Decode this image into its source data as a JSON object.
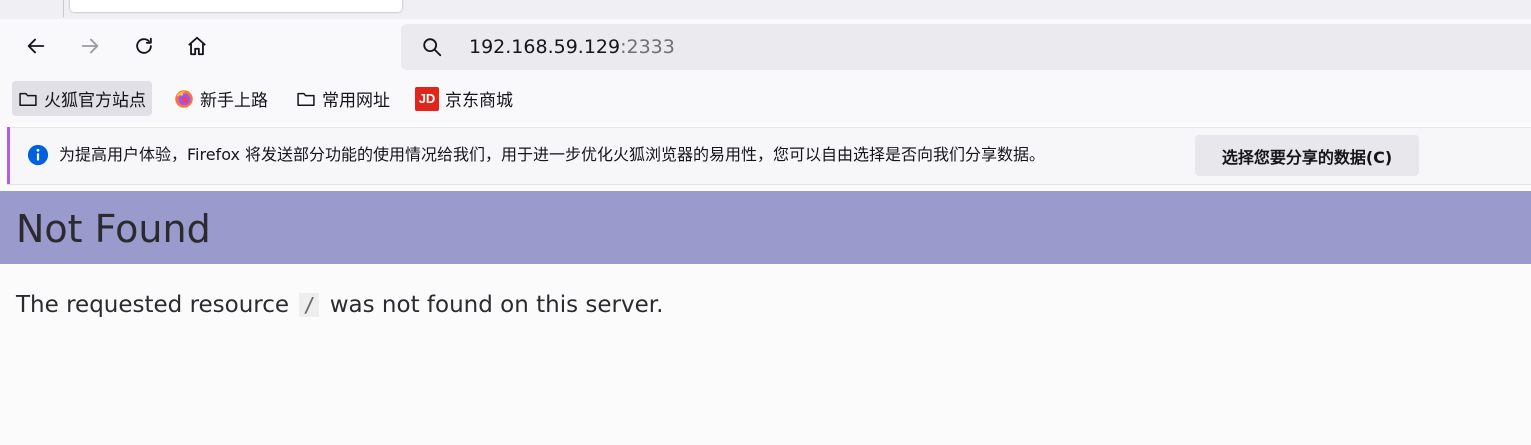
{
  "browser": {
    "url_host": "192.168.59.129",
    "url_port": ":2333",
    "nav_icons": [
      "back-arrow-icon",
      "forward-arrow-icon",
      "reload-icon",
      "home-icon",
      "search-icon"
    ]
  },
  "bookmarks": [
    {
      "label": "火狐官方站点",
      "icon": "folder-icon"
    },
    {
      "label": "新手上路",
      "icon": "firefox-icon"
    },
    {
      "label": "常用网址",
      "icon": "folder-icon"
    },
    {
      "label": "京东商城",
      "icon": "jd-icon",
      "icon_text": "JD"
    }
  ],
  "notification": {
    "message": "为提高用户体验，Firefox 将发送部分功能的使用情况给我们，用于进一步优化火狐浏览器的易用性，您可以自由选择是否向我们分享数据。",
    "button_label": "选择您要分享的数据(C)"
  },
  "page": {
    "title": "Not Found",
    "body_before": "The requested resource ",
    "resource": "/",
    "body_after": " was not found on this server."
  },
  "colors": {
    "header_bg": "#9a9acc",
    "notification_accent": "#b45cf0",
    "info_icon": "#0060df",
    "jd_red": "#e1251b"
  }
}
